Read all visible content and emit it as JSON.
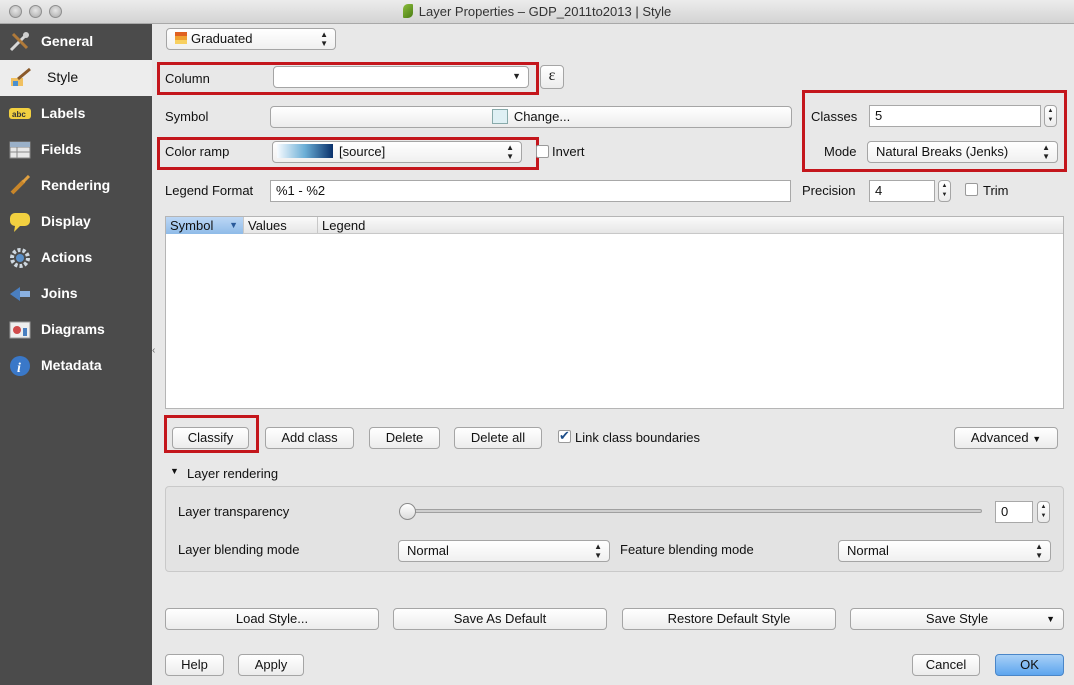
{
  "window": {
    "title": "Layer Properties – GDP_2011to2013 | Style"
  },
  "sidebar": {
    "items": [
      {
        "label": "General",
        "icon": "tools-icon"
      },
      {
        "label": "Style",
        "icon": "brush-icon",
        "active": true
      },
      {
        "label": "Labels",
        "icon": "abc-label-icon"
      },
      {
        "label": "Fields",
        "icon": "table-icon"
      },
      {
        "label": "Rendering",
        "icon": "paintbrush-icon"
      },
      {
        "label": "Display",
        "icon": "speech-bubble-icon"
      },
      {
        "label": "Actions",
        "icon": "gear-icon"
      },
      {
        "label": "Joins",
        "icon": "join-icon"
      },
      {
        "label": "Diagrams",
        "icon": "diagram-icon"
      },
      {
        "label": "Metadata",
        "icon": "info-icon"
      }
    ]
  },
  "style": {
    "renderer": "Graduated",
    "column_label": "Column",
    "column_value": "",
    "expression_button": "ε",
    "symbol_label": "Symbol",
    "symbol_button": "Change...",
    "color_ramp_label": "Color ramp",
    "color_ramp_value": "[source]",
    "invert_label": "Invert",
    "invert_checked": false,
    "classes_label": "Classes",
    "classes_value": "5",
    "mode_label": "Mode",
    "mode_value": "Natural Breaks (Jenks)",
    "legend_format_label": "Legend Format",
    "legend_format_value": "%1 - %2",
    "precision_label": "Precision",
    "precision_value": "4",
    "trim_label": "Trim",
    "trim_checked": false
  },
  "table": {
    "columns": [
      "Symbol",
      "Values",
      "Legend"
    ],
    "rows": []
  },
  "class_buttons": {
    "classify": "Classify",
    "add_class": "Add class",
    "delete": "Delete",
    "delete_all": "Delete all",
    "link_label": "Link class boundaries",
    "link_checked": true,
    "advanced": "Advanced"
  },
  "layer_rendering": {
    "header": "Layer rendering",
    "transparency_label": "Layer transparency",
    "transparency_value": "0",
    "blending_label": "Layer blending mode",
    "blending_value": "Normal",
    "feature_blending_label": "Feature blending mode",
    "feature_blending_value": "Normal"
  },
  "style_buttons": {
    "load": "Load Style...",
    "save_default": "Save As Default",
    "restore_default": "Restore Default Style",
    "save": "Save Style"
  },
  "dialog_buttons": {
    "help": "Help",
    "apply": "Apply",
    "cancel": "Cancel",
    "ok": "OK"
  },
  "colors": {
    "sidebar_bg": "#4b4b4b",
    "highlight_red": "#c4161c",
    "ok_blue": "#5da5ee"
  }
}
